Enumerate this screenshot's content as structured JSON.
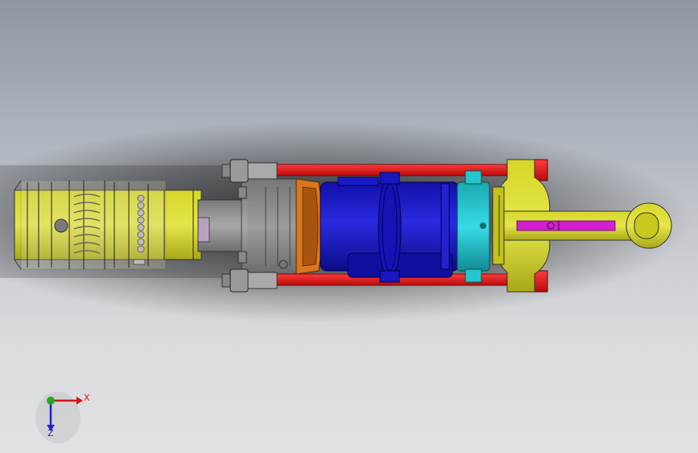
{
  "viewport": {
    "background_top": "#8e96a1",
    "background_bottom": "#e1e2e4"
  },
  "model": {
    "parts": [
      {
        "name": "handle-tube",
        "color": "#cccc1f"
      },
      {
        "name": "shaft",
        "color": "#8c8c8c"
      },
      {
        "name": "flange-orange",
        "color": "#d9771e"
      },
      {
        "name": "cylinder-body",
        "color": "#1a1ac8"
      },
      {
        "name": "piston-ring",
        "color": "#26c6cf"
      },
      {
        "name": "tie-rods",
        "color": "#e02020"
      },
      {
        "name": "end-cap",
        "color": "#dcdc24"
      },
      {
        "name": "rod-slot",
        "color": "#d020d0"
      }
    ]
  },
  "triad": {
    "x_label": "X",
    "z_label": "Z",
    "x_color": "#cc1a1a",
    "y_color": "#22aa22",
    "z_color": "#2020cc"
  }
}
